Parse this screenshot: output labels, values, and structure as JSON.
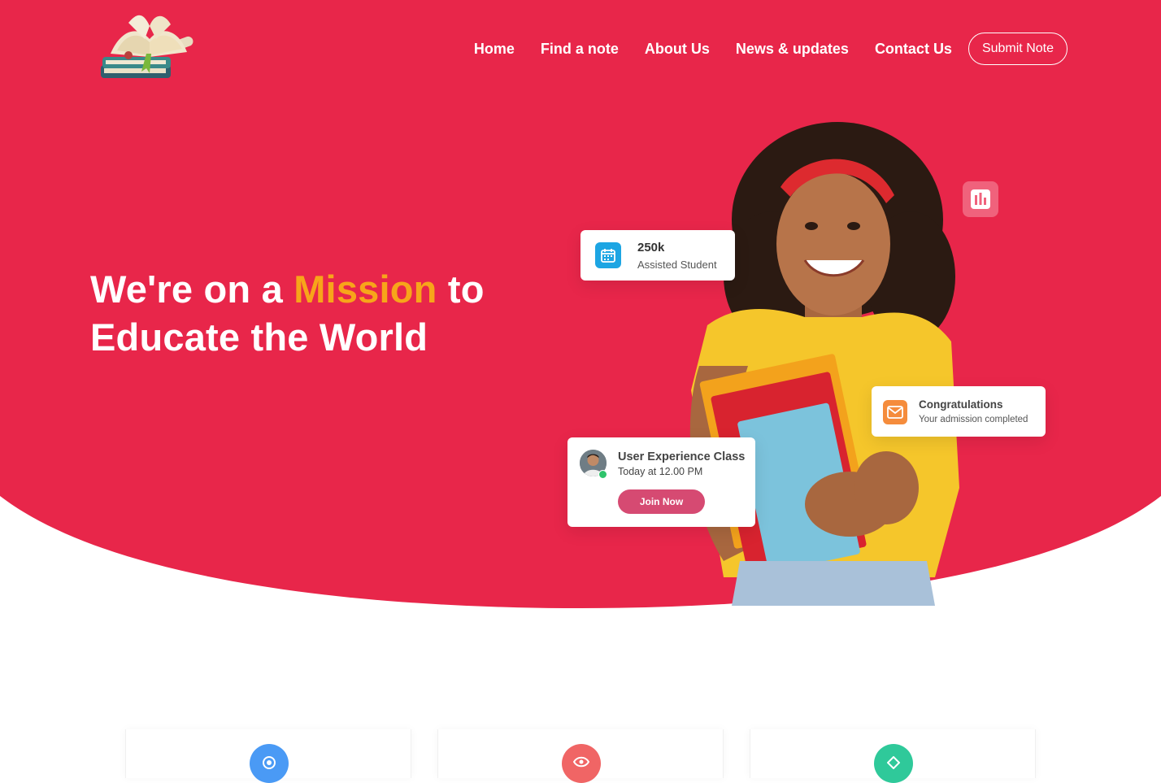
{
  "colors": {
    "brand": "#e8264a",
    "accent": "#f7a51a",
    "join": "#d64a72"
  },
  "logo": {
    "icon": "open-book-logo-icon"
  },
  "nav": {
    "items": [
      {
        "label": "Home"
      },
      {
        "label": "Find a note"
      },
      {
        "label": "About Us"
      },
      {
        "label": "News & updates"
      },
      {
        "label": "Contact Us"
      }
    ],
    "submit_label": "Submit Note"
  },
  "hero": {
    "line1_pre": "We're on a ",
    "line1_accent": "Mission",
    "line1_post": " to",
    "line2": "Educate the World"
  },
  "cards": {
    "stat": {
      "icon": "calendar-icon",
      "value": "250k",
      "label": "Assisted Student"
    },
    "congrats": {
      "icon": "mail-icon",
      "title": "Congratulations",
      "subtitle": "Your admission completed"
    },
    "class": {
      "icon": "avatar",
      "title": "User Experience Class",
      "time": "Today at 12.00 PM",
      "button": "Join Now"
    },
    "chart_tile": {
      "icon": "bar-chart-icon"
    }
  },
  "features": [
    {
      "icon": "target-icon",
      "color": "#4a9af5"
    },
    {
      "icon": "eye-icon",
      "color": "#f06565"
    },
    {
      "icon": "diamond-icon",
      "color": "#2fc99a"
    }
  ]
}
